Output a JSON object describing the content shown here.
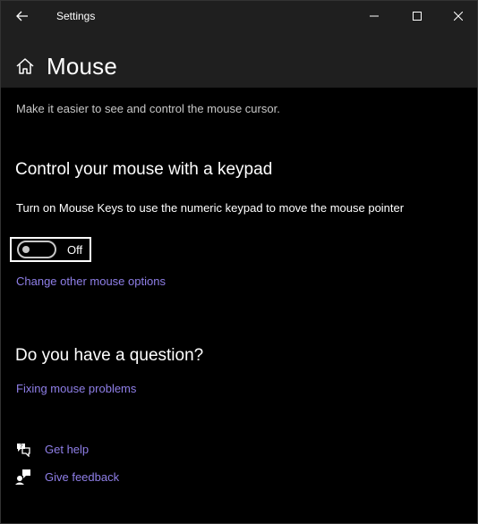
{
  "window": {
    "title": "Settings"
  },
  "header": {
    "page_title": "Mouse"
  },
  "main": {
    "description": "Make it easier to see and control the mouse cursor.",
    "keypad_section": {
      "title": "Control your mouse with a keypad",
      "toggle_label": "Turn on Mouse Keys to use the numeric keypad to move the mouse pointer",
      "toggle_state": "Off",
      "toggle_on": false,
      "other_options_link": "Change other mouse options"
    },
    "question_section": {
      "title": "Do you have a question?",
      "link": "Fixing mouse problems"
    },
    "help_links": {
      "get_help": "Get help",
      "give_feedback": "Give feedback"
    }
  },
  "colors": {
    "background": "#000000",
    "chrome": "#1f1f1f",
    "link": "#8f7fe8",
    "text": "#ffffff",
    "secondary_text": "#c8c8c8"
  },
  "icons": [
    "back-arrow-icon",
    "minimize-icon",
    "maximize-icon",
    "close-icon",
    "home-icon",
    "get-help-icon",
    "give-feedback-icon"
  ]
}
